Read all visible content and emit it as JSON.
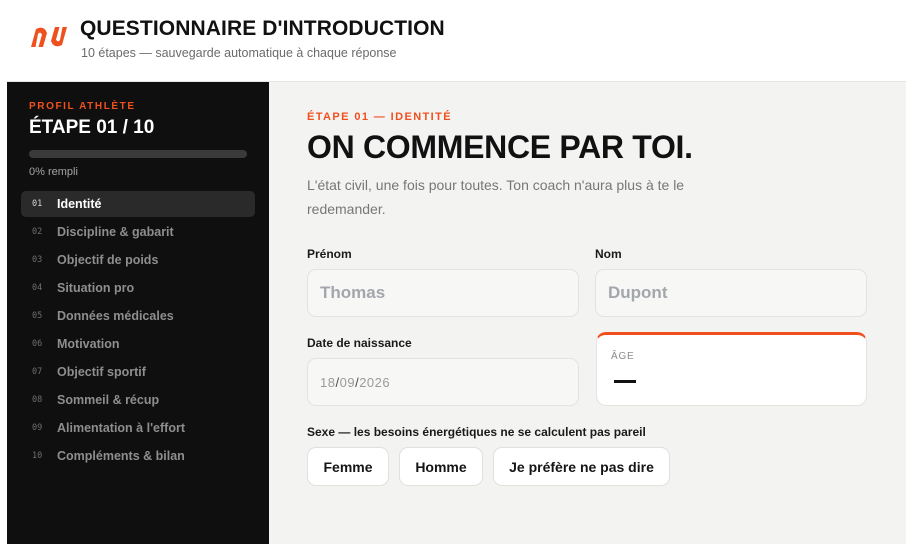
{
  "header": {
    "title": "QUESTIONNAIRE D'INTRODUCTION",
    "subtitle": "10 étapes — sauvegarde automatique à chaque réponse"
  },
  "sidebar": {
    "kicker": "PROFIL ATHLÈTE",
    "step_count": "ÉTAPE 01 / 10",
    "progress_fraction": 0,
    "progress_text": "0% rempli",
    "steps": [
      {
        "num": "01",
        "label": "Identité",
        "active": true
      },
      {
        "num": "02",
        "label": "Discipline & gabarit",
        "active": false
      },
      {
        "num": "03",
        "label": "Objectif de poids",
        "active": false
      },
      {
        "num": "04",
        "label": "Situation pro",
        "active": false
      },
      {
        "num": "05",
        "label": "Données médicales",
        "active": false
      },
      {
        "num": "06",
        "label": "Motivation",
        "active": false
      },
      {
        "num": "07",
        "label": "Objectif sportif",
        "active": false
      },
      {
        "num": "08",
        "label": "Sommeil & récup",
        "active": false
      },
      {
        "num": "09",
        "label": "Alimentation à l'effort",
        "active": false
      },
      {
        "num": "10",
        "label": "Compléments & bilan",
        "active": false
      }
    ]
  },
  "main": {
    "eyebrow": "ÉTAPE 01 — IDENTITÉ",
    "title": "ON COMMENCE PAR TOI.",
    "intro": "L'état civil, une fois pour toutes. Ton coach n'aura plus à te le redemander.",
    "prenom": {
      "label": "Prénom",
      "placeholder": "Thomas",
      "value": ""
    },
    "nom": {
      "label": "Nom",
      "placeholder": "Dupont",
      "value": ""
    },
    "naissance": {
      "label": "Date de naissance",
      "day": "18",
      "month": "09",
      "year": "2026",
      "sep": "/"
    },
    "age": {
      "label": "ÂGE",
      "value": "—"
    },
    "sexe": {
      "label": "Sexe — les besoins énergétiques ne se calculent pas pareil",
      "options": [
        "Femme",
        "Homme",
        "Je préfère ne pas dire"
      ]
    }
  },
  "colors": {
    "accent": "#f0501e",
    "sidebar_bg": "#0f0f0f",
    "page_bg": "#f3f3f2"
  },
  "icons": {
    "logo": "brand-logo-icon"
  }
}
